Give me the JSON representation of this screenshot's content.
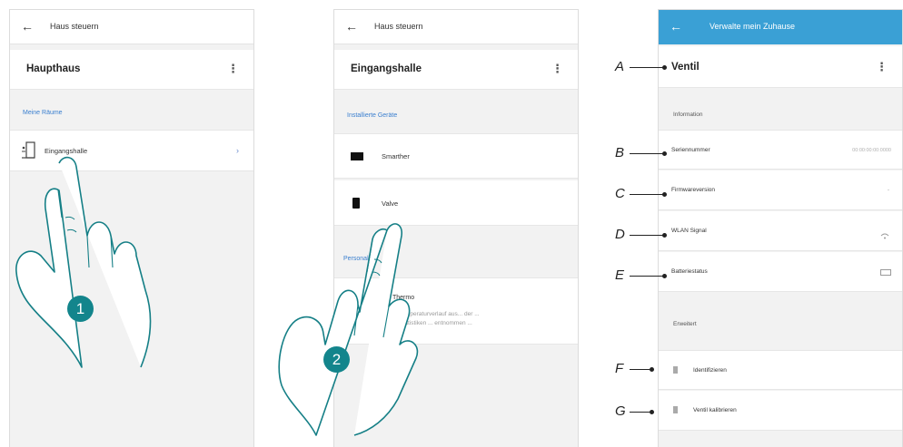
{
  "screen1": {
    "back_icon": "arrow-left-icon",
    "title": "Haus steuern",
    "house_name": "Haupthaus",
    "menu_icon": "kebab-icon",
    "section_label": "Meine Räume",
    "room_label": "Eingangshalle",
    "step_number": "1"
  },
  "screen2": {
    "title": "Haus steuern",
    "room_name": "Eingangshalle",
    "section_label": "Installierte Geräte",
    "devices": [
      "Smarther",
      "Valve"
    ],
    "section2_label": "Personal",
    "extra_title": "Thermo",
    "extra_text": "... Temperaturverlauf aus... der ...",
    "extra_text2": "... Statistiken ... entnommen ...",
    "step_number": "2"
  },
  "screen3": {
    "title": "Verwalte mein Zuhause",
    "header_color": "#3aa0d5",
    "device_name": "Ventil",
    "information_label": "Information",
    "rows": [
      {
        "label": "Seriennummer",
        "value": "00:00:00:00:0000"
      },
      {
        "label": "Firmwareversion",
        "value": "-"
      },
      {
        "label": "WLAN Signal",
        "value": "wifi-icon"
      },
      {
        "label": "Batteriestatus",
        "value": "battery-icon"
      }
    ],
    "advanced_label": "Erweitert",
    "advanced_rows": [
      {
        "label": "Identifizieren"
      },
      {
        "label": "Ventil kalibrieren"
      }
    ]
  },
  "callouts": [
    "A",
    "B",
    "C",
    "D",
    "E",
    "F",
    "G"
  ],
  "accent_color": "#13858c"
}
